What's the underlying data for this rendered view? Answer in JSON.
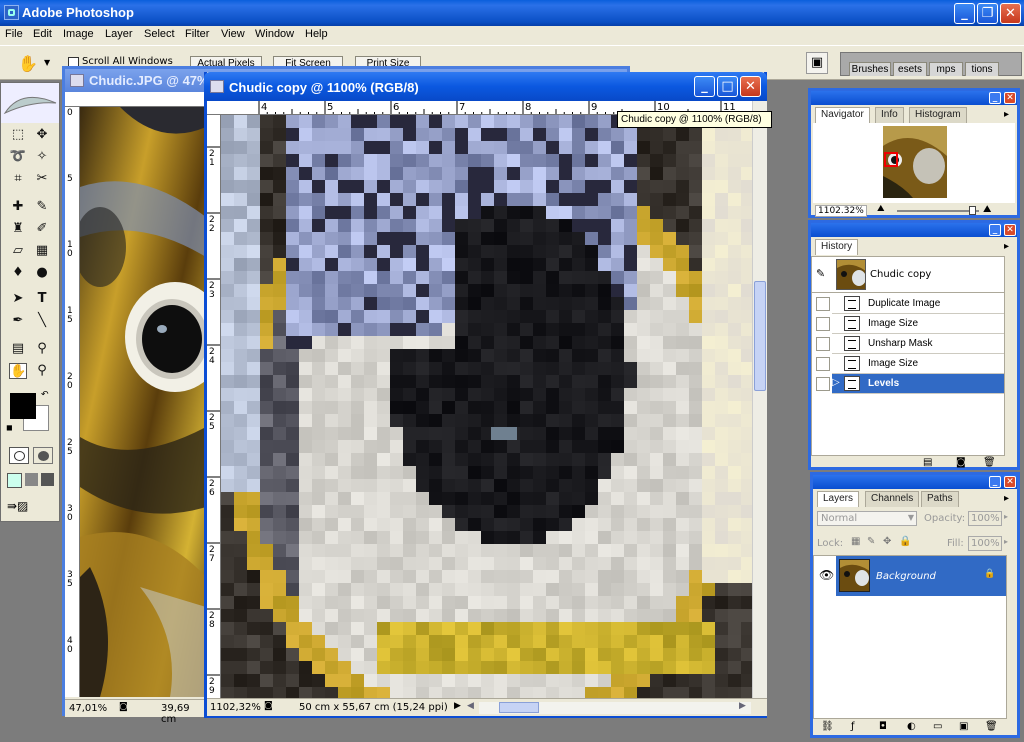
{
  "app": {
    "title": "Adobe Photoshop"
  },
  "menu": [
    "File",
    "Edit",
    "Image",
    "Layer",
    "Select",
    "Filter",
    "View",
    "Window",
    "Help"
  ],
  "options": {
    "scroll_all": "Scroll All Windows",
    "actual_pixels": "Actual Pixels",
    "fit_screen": "Fit Screen",
    "print_size": "Print Size",
    "well_tabs": [
      "Brushes",
      "esets",
      "mps",
      "tions"
    ]
  },
  "doc_back": {
    "title": "Chudic.JPG @ 47%",
    "zoom": "47,01%",
    "size": "39,69 cm",
    "v_ruler": [
      "0",
      "5",
      "1\n0",
      "1\n5",
      "2\n0",
      "2\n5",
      "3\n0",
      "3\n5",
      "4\n0"
    ]
  },
  "doc_front": {
    "title": "Chudic copy @ 1100% (RGB/8)",
    "tooltip": "Chudic copy @ 1100% (RGB/8)",
    "zoom": "1102,32%",
    "doc_info": "50 cm x 55,67 cm (15,24 ppi)",
    "h_ruler": [
      "4",
      "5",
      "6",
      "7",
      "8",
      "9",
      "10",
      "11"
    ],
    "v_ruler": [
      "2\n1",
      "2\n2",
      "2\n3",
      "2\n4",
      "2\n5",
      "2\n6",
      "2\n7",
      "2\n8",
      "2\n9"
    ]
  },
  "navigator": {
    "tabs": [
      "Navigator",
      "Info",
      "Histogram"
    ],
    "zoom": "1102.32%"
  },
  "history": {
    "tab": "History",
    "snapshot": "Chudic copy",
    "items": [
      "Duplicate Image",
      "Image Size",
      "Unsharp Mask",
      "Image Size",
      "Levels"
    ],
    "selected_index": 4
  },
  "layers": {
    "tabs": [
      "Layers",
      "Channels",
      "Paths"
    ],
    "blend_mode": "Normal",
    "opacity_label": "Opacity:",
    "opacity": "100%",
    "lock_label": "Lock:",
    "fill_label": "Fill:",
    "fill": "100%",
    "layer_name": "Background"
  },
  "colors": {
    "xp_blue": "#0a4fc4",
    "selection": "#316ac5"
  }
}
